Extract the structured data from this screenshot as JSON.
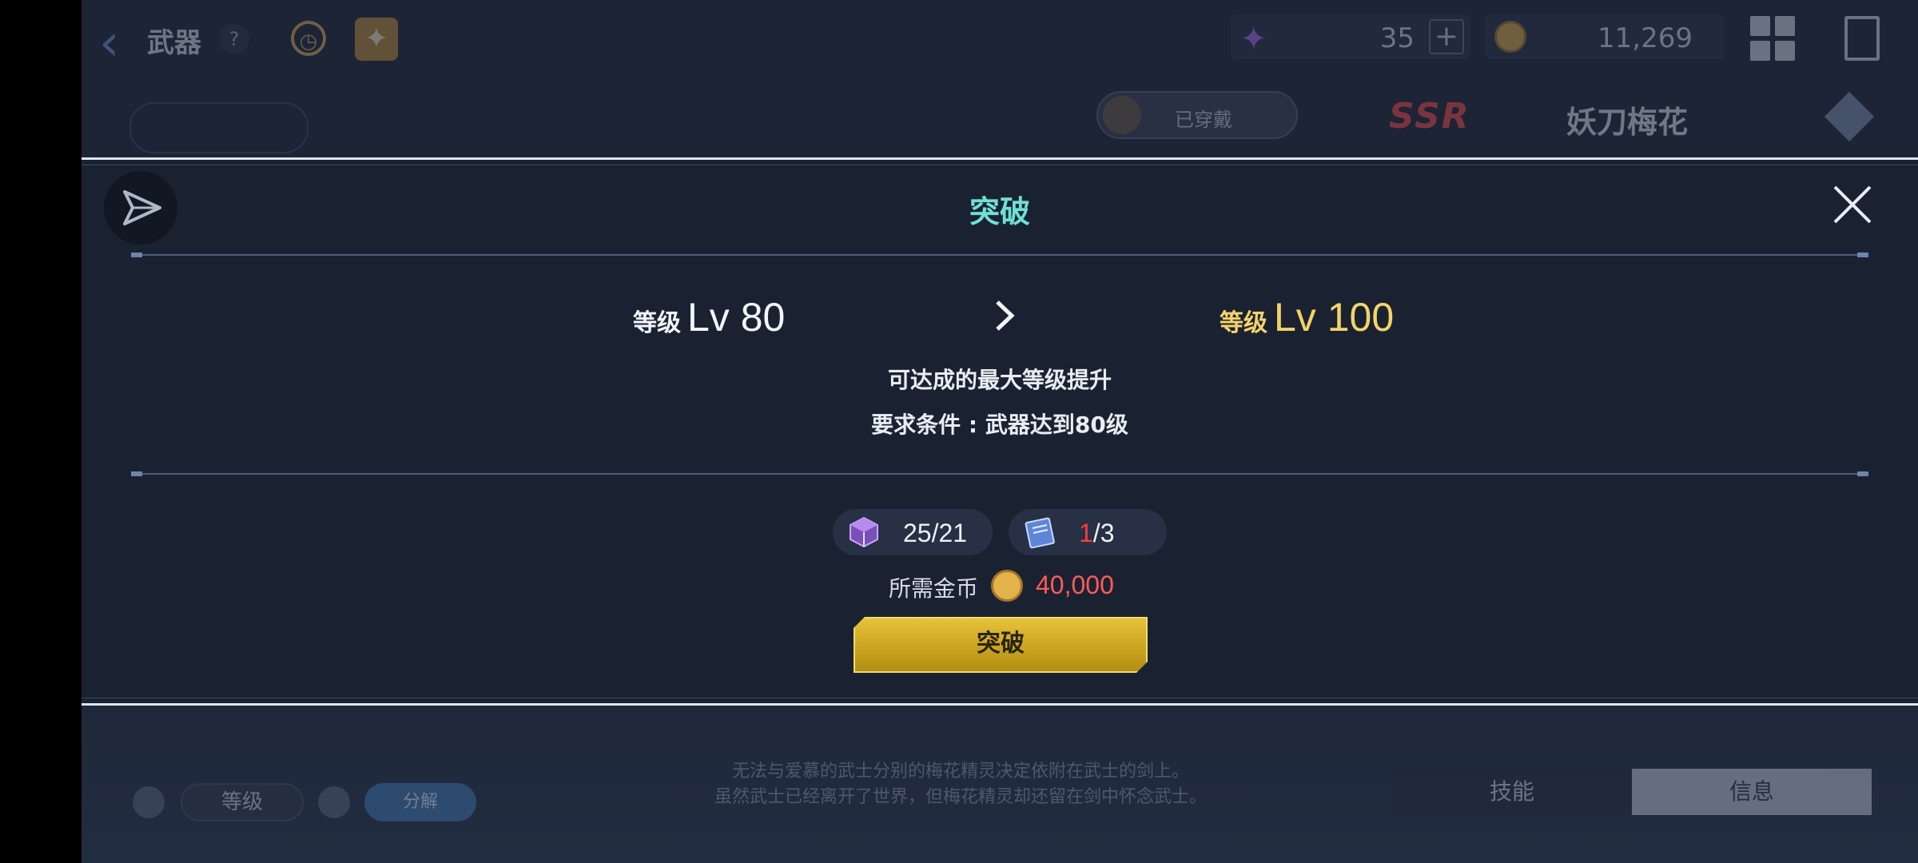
{
  "header": {
    "title": "武器",
    "help": "?",
    "gem_count": "35",
    "coin_count": "11,269",
    "plus": "+"
  },
  "weapon": {
    "worn_label": "已穿戴",
    "rarity": "SSR",
    "name": "妖刀梅花"
  },
  "modal": {
    "title": "突破",
    "current_level_label": "等级",
    "current_level_value": "Lv 80",
    "next_level_label": "等级",
    "next_level_value": "Lv 100",
    "desc_line1": "可达成的最大等级提升",
    "desc_line2": "要求条件 : 武器达到80级",
    "material_cube": "25/21",
    "material_book_have": "1",
    "material_book_need": "/3",
    "gold_label": "所需金币",
    "gold_cost": "40,000",
    "button_label": "突破"
  },
  "background": {
    "story_line1": "无法与爱慕的武士分别的梅花精灵决定依附在武士的剑上。",
    "story_line2": "虽然武士已经离开了世界，但梅花精灵却还留在剑中怀念武士。",
    "sort_label": "等级",
    "decompose_label": "分解",
    "tab_skill": "技能",
    "tab_info": "信息"
  },
  "colors": {
    "title_teal": "#6fe0d6",
    "next_level_gold": "#f5d36a",
    "cost_red": "#ff5b5b",
    "button_gold": "#e7c23a"
  }
}
